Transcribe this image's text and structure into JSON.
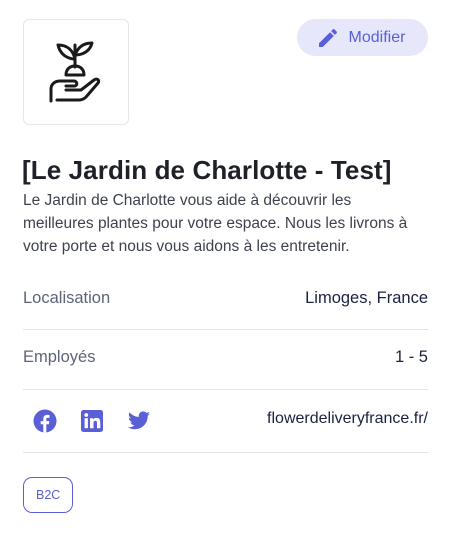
{
  "company": {
    "name": "[Le Jardin de Charlotte - Test]",
    "description": "Le Jardin de Charlotte vous aide à découvrir les meilleures plantes pour votre espace. Nous les livrons à votre porte et nous vous aidons à les entretenir.",
    "logo_icon": "plant-in-hand-icon"
  },
  "actions": {
    "edit_label": "Modifier",
    "edit_icon": "pencil-icon"
  },
  "details": [
    {
      "label": "Localisation",
      "value": "Limoges, France"
    },
    {
      "label": "Employés",
      "value": "1 - 5"
    }
  ],
  "socials": {
    "icons": [
      "facebook-icon",
      "linkedin-icon",
      "twitter-icon"
    ],
    "website": "flowerdeliveryfrance.fr/"
  },
  "tags": [
    "B2C"
  ],
  "colors": {
    "accent": "#5a5fd6",
    "accent_bg": "#e6e7fb",
    "text": "#1f2128",
    "muted": "#5d6479"
  }
}
